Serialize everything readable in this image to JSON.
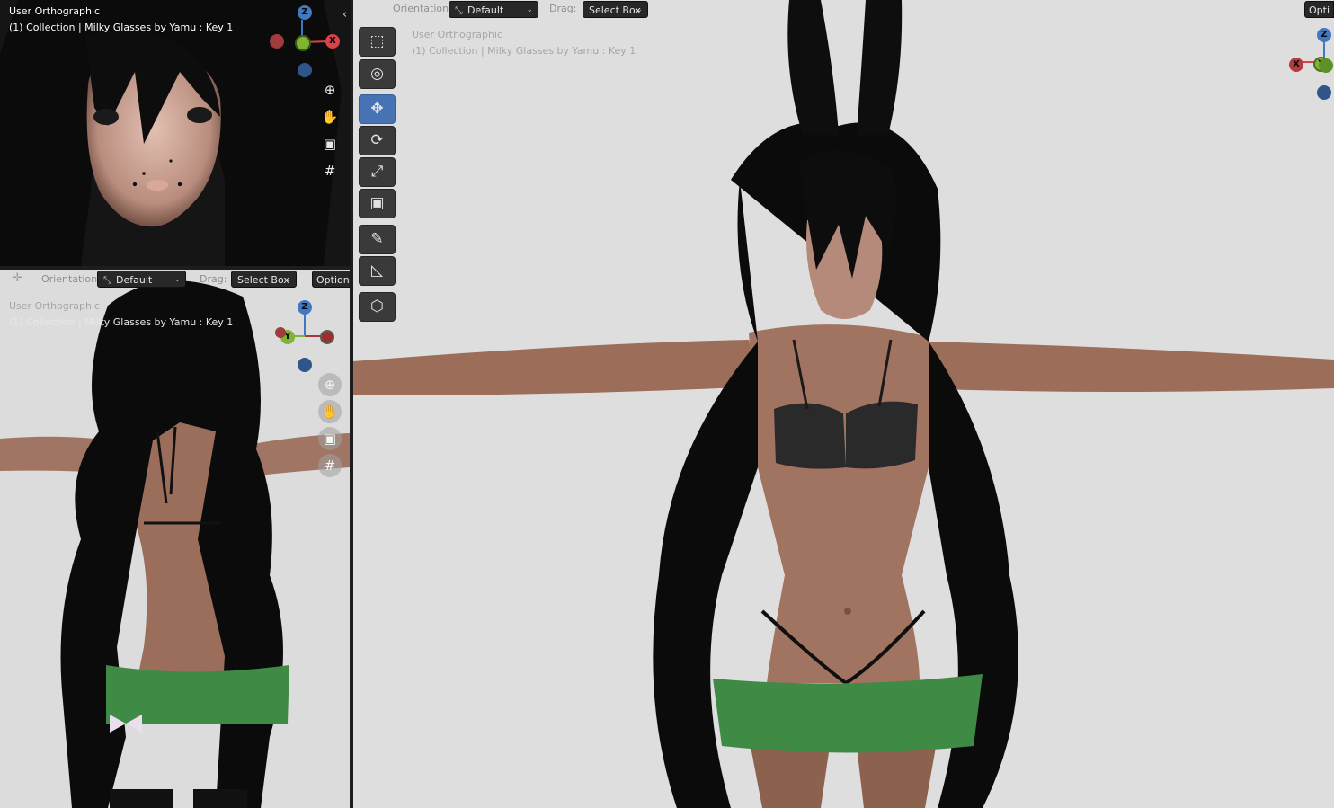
{
  "viewport_top_left": {
    "view_label": "User Orthographic",
    "collection_label": "(1) Collection | Milky Glasses by Yamu : Key 1",
    "collapse_arrow": "‹",
    "gizmo": {
      "x": "X",
      "y": "Y",
      "z": "Z"
    },
    "nav": [
      "zoom-icon",
      "hand-icon",
      "camera-icon",
      "grid-icon"
    ]
  },
  "viewport_bottom_left": {
    "view_label": "User Orthographic",
    "collection_label": "(1) Collection | Milky Glasses by Yamu : Key 1",
    "header": {
      "orientation_label": "Orientation:",
      "orientation_value": "Default",
      "drag_label": "Drag:",
      "drag_value": "Select Box",
      "options_label": "Option"
    },
    "gizmo": {
      "x": "X",
      "y": "Y",
      "z": "Z"
    },
    "nav": [
      "zoom-icon",
      "hand-icon",
      "camera-icon",
      "grid-icon"
    ]
  },
  "viewport_main": {
    "view_label": "User Orthographic",
    "collection_label": "(1) Collection | Milky Glasses by Yamu : Key 1",
    "header": {
      "orientation_label": "Orientation:",
      "orientation_value": "Default",
      "drag_label": "Drag:",
      "drag_value": "Select Box",
      "options_label": "Opti"
    },
    "gizmo": {
      "x": "X",
      "y": "Y",
      "z": "Z"
    },
    "toolbar": [
      {
        "name": "select-box-tool",
        "icon": "select-box-icon"
      },
      {
        "name": "cursor-tool",
        "icon": "cursor-icon"
      },
      {
        "name": "move-tool",
        "icon": "move-icon",
        "active": true
      },
      {
        "name": "rotate-tool",
        "icon": "rotate-icon"
      },
      {
        "name": "scale-tool",
        "icon": "scale-icon"
      },
      {
        "name": "transform-tool",
        "icon": "transform-icon"
      },
      {
        "name": "annotate-tool",
        "icon": "annotate-icon"
      },
      {
        "name": "measure-tool",
        "icon": "measure-icon"
      },
      {
        "name": "add-cube-tool",
        "icon": "add-cube-icon"
      }
    ]
  },
  "colors": {
    "axis_x": "#d8424a",
    "axis_y": "#7fb435",
    "axis_z": "#4178c0",
    "active_tool": "#4772b3",
    "hair": "#0c0c0c",
    "skin": "#9c6d58",
    "shorts": "#3f8a45"
  }
}
